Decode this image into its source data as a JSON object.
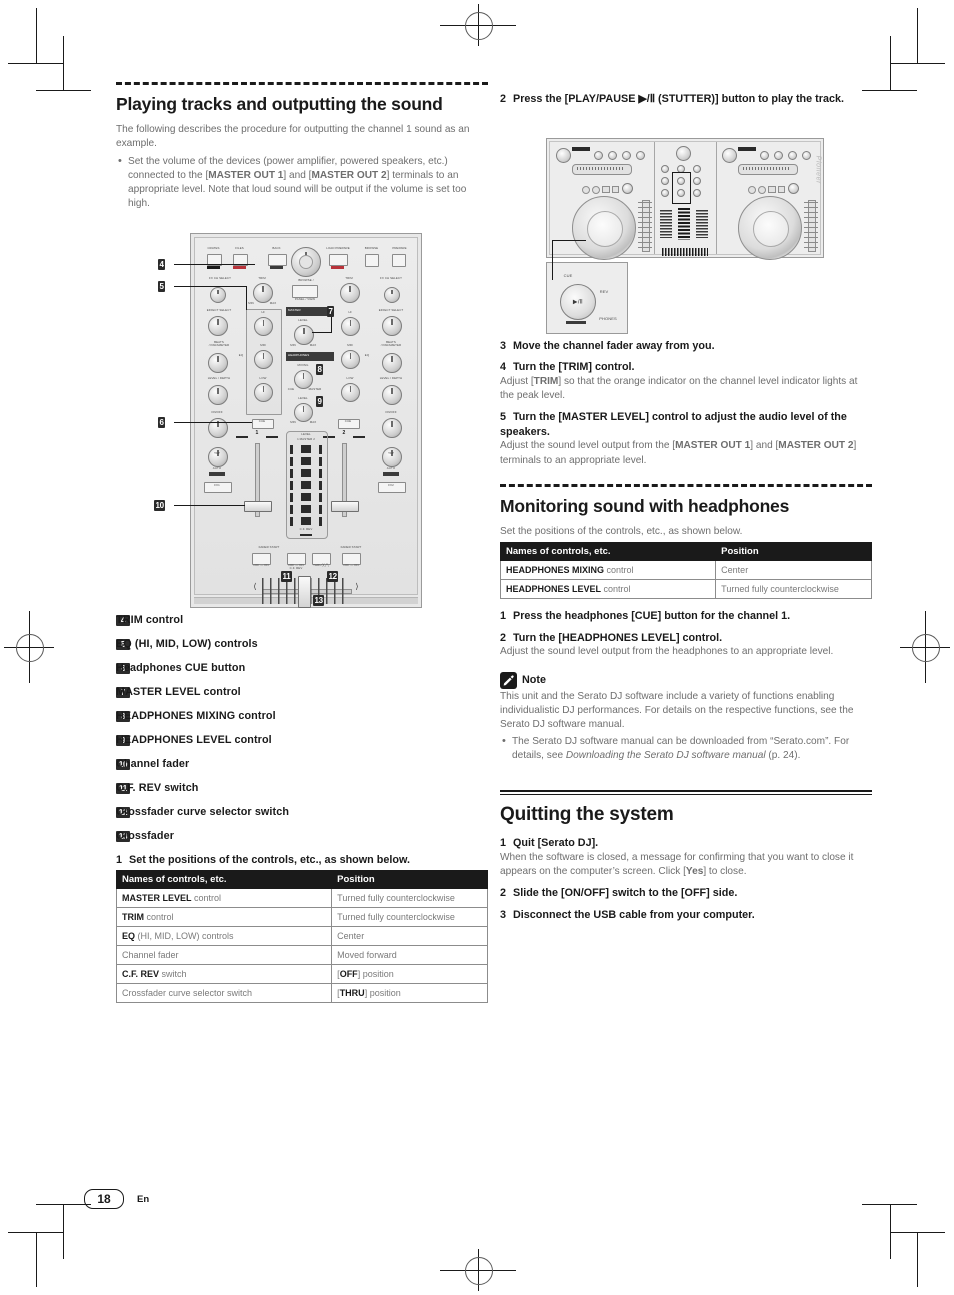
{
  "page": {
    "number": "18",
    "language": "En"
  },
  "left": {
    "heading": "Playing tracks and outputting the sound",
    "intro": "The following describes the procedure for outputting the channel 1 sound as an example.",
    "bullet1_pre": "Set the volume of the devices (power amplifier, powered speakers, etc.) connected to the [",
    "bullet1_b1": "MASTER OUT 1",
    "bullet1_mid": "] and [",
    "bullet1_b2": "MASTER OUT 2",
    "bullet1_post": "] terminals to an appropriate level. Note that loud sound will be output if the volume is set too high.",
    "legend": [
      {
        "num": "4",
        "label": "TRIM control"
      },
      {
        "num": "5",
        "label": "EQ (HI, MID, LOW) controls"
      },
      {
        "num": "6",
        "label": "Headphones CUE button"
      },
      {
        "num": "7",
        "label": "MASTER LEVEL control"
      },
      {
        "num": "8",
        "label": "HEADPHONES MIXING control"
      },
      {
        "num": "9",
        "label": "HEADPHONES LEVEL control"
      },
      {
        "num": "10",
        "label": "Channel fader"
      },
      {
        "num": "11",
        "label": "C.F. REV switch"
      },
      {
        "num": "12",
        "label": "Crossfader curve selector switch"
      },
      {
        "num": "13",
        "label": "Crossfader"
      }
    ],
    "step1_num": "1",
    "step1_text": "Set the positions of the controls, etc., as shown below.",
    "table": {
      "headers": [
        "Names of controls, etc.",
        "Position"
      ],
      "rows": [
        {
          "name_b": "MASTER LEVEL",
          "name_r": " control",
          "pos": "Turned fully counterclockwise",
          "pos_b": ""
        },
        {
          "name_b": "TRIM",
          "name_r": " control",
          "pos": "Turned fully counterclockwise",
          "pos_b": ""
        },
        {
          "name_b": "EQ",
          "name_r": " (HI, MID, LOW) controls",
          "pos": "Center",
          "pos_b": ""
        },
        {
          "name_b": "",
          "name_r": "Channel fader",
          "pos": "Moved forward",
          "pos_b": ""
        },
        {
          "name_b": "C.F. REV",
          "name_r": " switch",
          "pos": "",
          "pos_b": "[OFF] position"
        },
        {
          "name_b": "",
          "name_r": "Crossfader curve selector switch",
          "pos": "",
          "pos_b": "[THRU] position"
        }
      ]
    }
  },
  "right": {
    "step2_num": "2",
    "step2_text": "Press the [PLAY/PAUSE ▶/Ⅱ (STUTTER)] button to play the track.",
    "step3_num": "3",
    "step3_text": "Move the channel fader away from you.",
    "step4_num": "4",
    "step4_text": "Turn the [TRIM] control.",
    "step4_desc_a": "Adjust [",
    "step4_desc_b": "TRIM",
    "step4_desc_c": "] so that the orange indicator on the channel level indicator lights at the peak level.",
    "step5_num": "5",
    "step5_text": "Turn the [MASTER LEVEL] control to adjust the audio level of the speakers.",
    "step5_desc_a": "Adjust the sound level output from the [",
    "step5_desc_b1": "MASTER OUT 1",
    "step5_desc_mid": "] and [",
    "step5_desc_b2": "MASTER OUT 2",
    "step5_desc_post": "] terminals to an appropriate level.",
    "mon_heading": "Monitoring sound with headphones",
    "mon_intro": "Set the positions of the controls, etc., as shown below.",
    "mon_table": {
      "headers": [
        "Names of controls, etc.",
        "Position"
      ],
      "rows": [
        {
          "name_b": "HEADPHONES MIXING",
          "name_r": " control",
          "pos": "Center"
        },
        {
          "name_b": "HEADPHONES LEVEL",
          "name_r": " control",
          "pos": "Turned fully counterclockwise"
        }
      ]
    },
    "mon_step1_num": "1",
    "mon_step1_text": "Press the headphones [CUE] button for the channel 1.",
    "mon_step2_num": "2",
    "mon_step2_text": "Turn the [HEADPHONES LEVEL] control.",
    "mon_step2_desc": "Adjust the sound level output from the headphones to an appropriate level.",
    "note_title": "Note",
    "note_body": "This unit and the Serato DJ software include a variety of functions enabling individualistic DJ performances. For details on the respective functions, see the Serato DJ software manual.",
    "note_bullet_a": "The Serato DJ software manual can be downloaded from “Serato.com”. For details, see ",
    "note_bullet_i": "Downloading the Serato DJ software manual",
    "note_bullet_b": " (p. 24).",
    "quit_heading": "Quitting the system",
    "quit_step1_num": "1",
    "quit_step1_text": "Quit [Serato DJ].",
    "quit_step1_desc_a": "When the software is closed, a message for confirming that you want to close it appears on the computer’s screen. Click [",
    "quit_step1_desc_b": "Yes",
    "quit_step1_desc_c": "] to close.",
    "quit_step2_num": "2",
    "quit_step2_text": "Slide the [ON/OFF] switch to the [OFF] side.",
    "quit_step3_num": "3",
    "quit_step3_text": "Disconnect the USB cable from your computer."
  },
  "mixer_figure": {
    "top_buttons": [
      "CRATES",
      "FILES",
      "BACK",
      "LOAD PREPARE",
      "BROWSE",
      "PREPARE"
    ],
    "browse_label": "BROWSE / ■",
    "panel_label": "PANEL / ■",
    "fx_label": "FX CH SELECT",
    "fx_opts": "1   MASTER\n2        MIC\n          AUX",
    "effect_select": "EFFECT SELECT",
    "beats": "BEATS\n/ PARAMETER",
    "level_depth": "LEVEL / DEPTH",
    "onoff": "ON/OFF",
    "tap": "TAP",
    "auto": "AUTO",
    "fx1": "FX1",
    "fx2": "FX2",
    "trim": "TRIM",
    "eq_hi": "HI",
    "eq_mid": "MID",
    "eq_low": "LOW",
    "eq": "EQ",
    "master": "MASTER",
    "level": "LEVEL",
    "headphones": "HEADPHONES",
    "mixing": "MIXING",
    "cue": "CUE",
    "min": "MIN",
    "max": "MAX",
    "ch1": "1",
    "ch2": "2",
    "level_meter": "LEVEL",
    "level_meter_sub": "1 MASTER 2",
    "cf_rev_meter": "C.F. REV",
    "fader_start": "FADER START",
    "off_on": "OFF — ON",
    "cf_rev": "C.F. REV",
    "thru": "THRU",
    "callouts": [
      "4",
      "5",
      "6",
      "7",
      "8",
      "9",
      "10",
      "11",
      "12",
      "13"
    ]
  },
  "deck_figure": {
    "brand": "Pioneer",
    "play_glyph": "▶/Ⅱ",
    "cue_label": "CUE",
    "rev_label": "REV",
    "phones_label": "PHONES"
  },
  "colors": {
    "ink": "#1a1a1a",
    "body_gray": "#6e6e6e",
    "table_border": "#8c8c8c",
    "panel": "#e8e8e8"
  }
}
